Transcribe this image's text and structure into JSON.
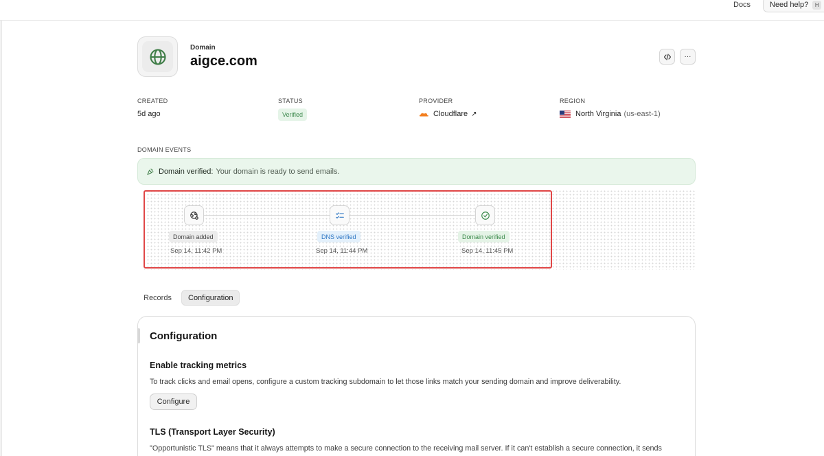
{
  "topbar": {
    "docs_label": "Docs",
    "help_label": "Need help?",
    "help_shortcut": "H"
  },
  "domain": {
    "eyebrow": "Domain",
    "name": "aigce.com",
    "icon": "globe-icon"
  },
  "header_actions": {
    "code_icon": "code-icon",
    "more_label": "···"
  },
  "meta": {
    "created_label": "CREATED",
    "created_value": "5d ago",
    "status_label": "STATUS",
    "status_value": "Verified",
    "provider_label": "PROVIDER",
    "provider_value": "Cloudflare",
    "provider_arrow": "↗",
    "region_label": "REGION",
    "region_value": "North Virginia",
    "region_code": "(us-east-1)"
  },
  "events": {
    "section_label": "DOMAIN EVENTS",
    "banner_title": "Domain verified:",
    "banner_message": "Your domain is ready to send emails.",
    "steps": [
      {
        "label": "Domain added",
        "time": "Sep 14, 11:42 PM",
        "icon": "globe-gear-icon"
      },
      {
        "label": "DNS verified",
        "time": "Sep 14, 11:44 PM",
        "icon": "checklist-icon"
      },
      {
        "label": "Domain verified",
        "time": "Sep 14, 11:45 PM",
        "icon": "check-circle-icon"
      }
    ]
  },
  "tabs": [
    {
      "label": "Records"
    },
    {
      "label": "Configuration"
    }
  ],
  "config": {
    "title": "Configuration",
    "tracking_heading": "Enable tracking metrics",
    "tracking_text": "To track clicks and email opens, configure a custom tracking subdomain to let those links match your sending domain and improve deliverability.",
    "configure_label": "Configure",
    "tls_heading": "TLS (Transport Layer Security)",
    "tls_text": "\"Opportunistic TLS\" means that it always attempts to make a secure connection to the receiving mail server. If it can't establish a secure connection, it sends"
  },
  "colors": {
    "verified_green": "#3f8a4f",
    "dns_blue": "#2f77c4",
    "highlight_red": "#e04646",
    "cloudflare_orange": "#f38020"
  }
}
